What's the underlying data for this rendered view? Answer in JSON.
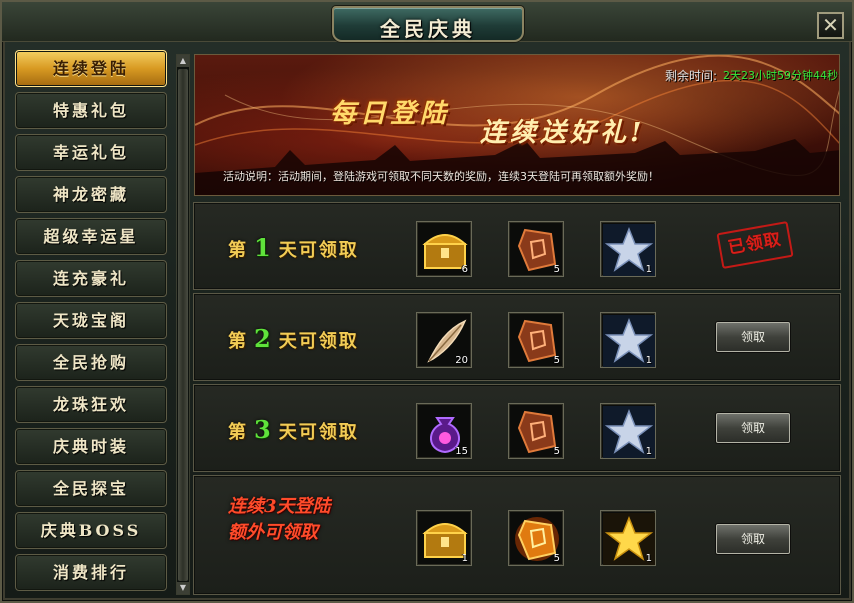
{
  "window": {
    "title": "全民庆典",
    "close_label": "✕"
  },
  "sidebar": {
    "items": [
      {
        "label": "连续登陆",
        "active": true
      },
      {
        "label": "特惠礼包"
      },
      {
        "label": "幸运礼包"
      },
      {
        "label": "神龙密藏"
      },
      {
        "label": "超级幸运星"
      },
      {
        "label": "连充豪礼"
      },
      {
        "label": "天珑宝阁"
      },
      {
        "label": "全民抢购"
      },
      {
        "label": "龙珠狂欢"
      },
      {
        "label": "庆典时装"
      },
      {
        "label": "全民探宝"
      },
      {
        "label": "庆典BOSS"
      },
      {
        "label": "消费排行"
      }
    ]
  },
  "banner": {
    "remaining_label": "剩余时间:",
    "remaining_value": "2天23小时59分钟44秒",
    "headline_1": "每日登陆",
    "headline_2": "连续送好礼!",
    "description": "活动说明：活动期间，登陆游戏可领取不同天数的奖励，连续3天登陆可再领取额外奖励！"
  },
  "rows": [
    {
      "prefix": "第",
      "day": "1",
      "suffix": "天可领取",
      "items": [
        {
          "icon": "golden-chest-icon",
          "count": "6"
        },
        {
          "icon": "rune-stone-icon",
          "count": "5"
        },
        {
          "icon": "silver-star-icon",
          "count": "1"
        }
      ],
      "status": "已领取"
    },
    {
      "prefix": "第",
      "day": "2",
      "suffix": "天可领取",
      "items": [
        {
          "icon": "feather-icon",
          "count": "20"
        },
        {
          "icon": "rune-stone-icon",
          "count": "5"
        },
        {
          "icon": "silver-star-icon",
          "count": "1"
        }
      ],
      "button": "领取"
    },
    {
      "prefix": "第",
      "day": "3",
      "suffix": "天可领取",
      "items": [
        {
          "icon": "purple-pouch-icon",
          "count": "15"
        },
        {
          "icon": "rune-stone-icon",
          "count": "5"
        },
        {
          "icon": "silver-star-icon",
          "count": "1"
        }
      ],
      "button": "领取"
    },
    {
      "bonus_line_1": "连续3天登陆",
      "bonus_line_2": "额外可领取",
      "items": [
        {
          "icon": "golden-chest-icon",
          "count": "1"
        },
        {
          "icon": "fire-rune-icon",
          "count": "5"
        },
        {
          "icon": "gold-star-icon",
          "count": "1"
        }
      ],
      "button": "领取"
    }
  ],
  "colors": {
    "accent_gold": "#f2cc55",
    "day_green": "#5fe23b",
    "bonus_red": "#ff4b2a",
    "timer_green": "#35e63a",
    "stamp_red": "#d81f19"
  }
}
